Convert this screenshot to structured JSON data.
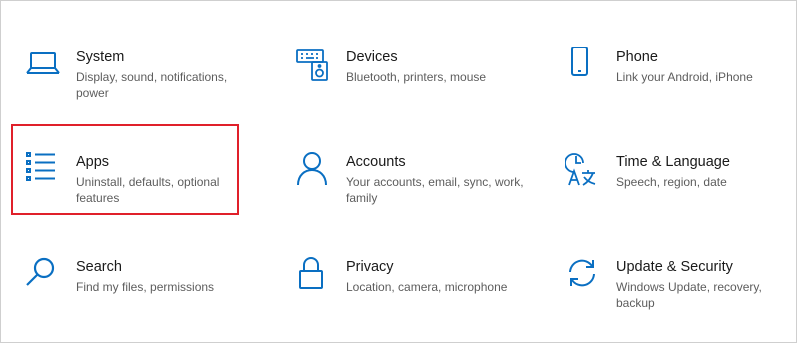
{
  "settings": {
    "accent_color": "#0a6fc2",
    "highlight_color": "#e0202a",
    "tiles": [
      {
        "title": "System",
        "desc": "Display, sound, notifications, power",
        "icon": "laptop-icon"
      },
      {
        "title": "Devices",
        "desc": "Bluetooth, printers, mouse",
        "icon": "keyboard-speaker-icon"
      },
      {
        "title": "Phone",
        "desc": "Link your Android, iPhone",
        "icon": "phone-icon"
      },
      {
        "title": "Apps",
        "desc": "Uninstall, defaults, optional features",
        "icon": "apps-list-icon"
      },
      {
        "title": "Accounts",
        "desc": "Your accounts, email, sync, work, family",
        "icon": "person-icon"
      },
      {
        "title": "Time & Language",
        "desc": "Speech, region, date",
        "icon": "time-language-icon"
      },
      {
        "title": "Search",
        "desc": "Find my files, permissions",
        "icon": "search-icon"
      },
      {
        "title": "Privacy",
        "desc": "Location, camera, microphone",
        "icon": "lock-icon"
      },
      {
        "title": "Update & Security",
        "desc": "Windows Update, recovery, backup",
        "icon": "sync-icon"
      }
    ]
  }
}
